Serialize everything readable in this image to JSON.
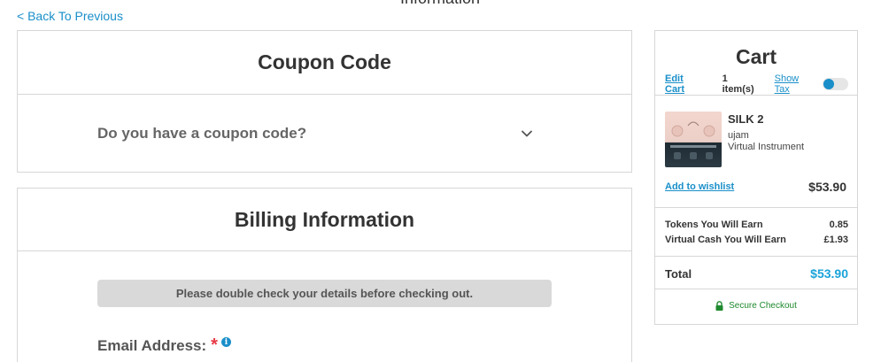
{
  "nav": {
    "back_label": "< Back To Previous",
    "top_heading": "Information"
  },
  "coupon": {
    "title": "Coupon Code",
    "question": "Do you have a coupon code?"
  },
  "billing": {
    "title": "Billing Information",
    "notice": "Please double check your details before checking out.",
    "email_label": "Email Address:",
    "required_mark": "*",
    "info_glyph": "i"
  },
  "cart": {
    "title": "Cart",
    "edit_label": "Edit Cart",
    "items_count": "1 item(s)",
    "show_tax_label": "Show Tax",
    "product": {
      "name": "SILK 2",
      "brand": "ujam",
      "type": "Virtual Instrument",
      "wishlist_label": "Add to wishlist",
      "price": "$53.90"
    },
    "earnings": [
      {
        "label": "Tokens You Will Earn",
        "value": "0.85"
      },
      {
        "label": "Virtual Cash You Will Earn",
        "value": "£1.93"
      }
    ],
    "total_label": "Total",
    "total_value": "$53.90",
    "secure_label": "Secure Checkout"
  },
  "colors": {
    "accent": "#1a8fc9",
    "total": "#1aa3d9",
    "secure": "#1e8a2e",
    "required": "#e63946"
  },
  "icons": [
    "chevron-down-icon",
    "info-icon",
    "lock-icon"
  ]
}
